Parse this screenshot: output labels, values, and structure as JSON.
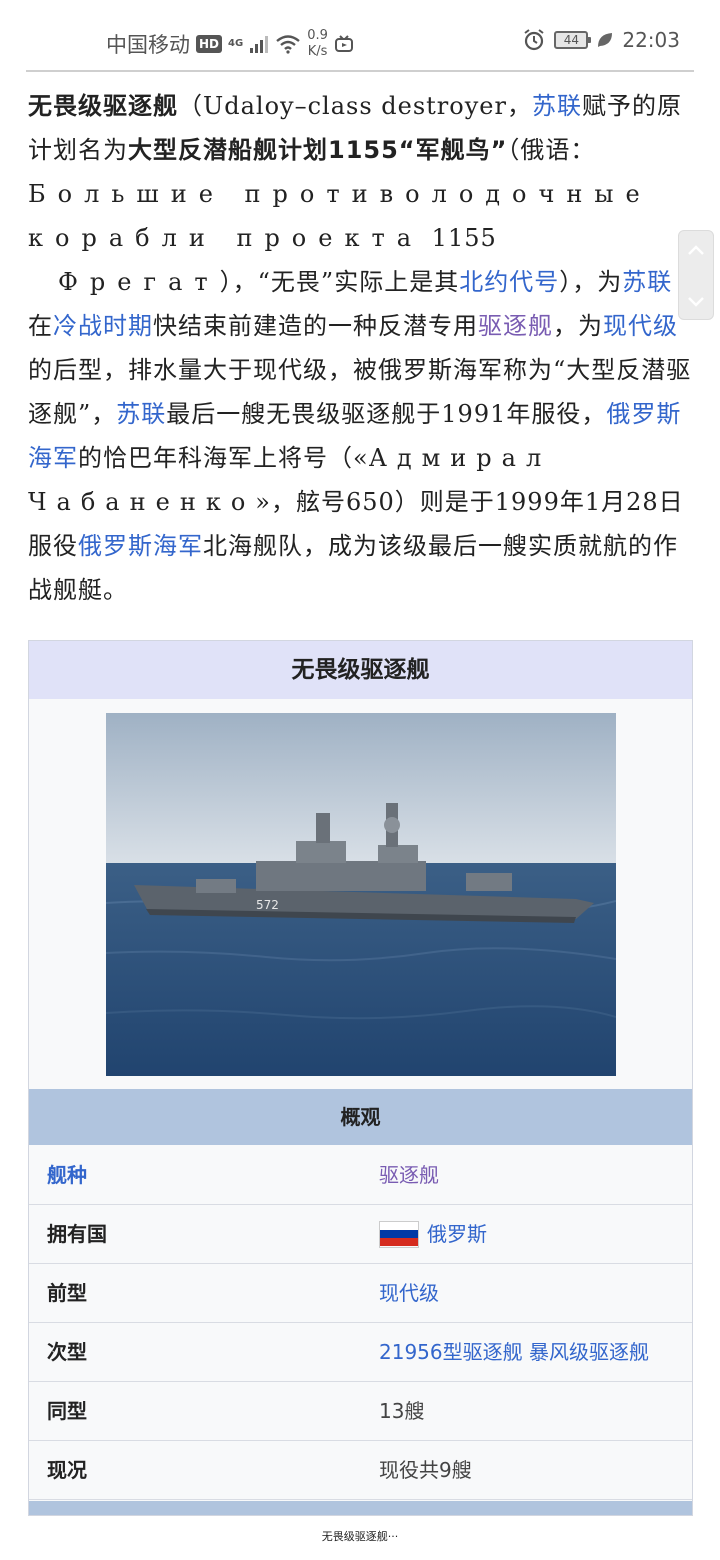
{
  "status_bar": {
    "carrier": "中国移动",
    "hd": "HD",
    "network": "4G",
    "speed_value": "0.9",
    "speed_unit": "K/s",
    "battery": "44",
    "time": "22:03"
  },
  "article": {
    "title_bold": "无畏级驱逐舰",
    "seg1": "（Udaloy–class destroyer，",
    "link_sulian1": "苏联",
    "seg2": "赋予的原计划名为",
    "plan_bold": "大型反潜船舰计划1155“军舰鸟”",
    "seg3": "（俄语：",
    "ru1": "Большие противолодочные",
    "ru2": "корабли проекта",
    "ru2_num": " 1155",
    "ru3": "Фрегат",
    "seg4": "），“无畏”实际上是其",
    "link_nato": "北约代号",
    "seg5": "），为",
    "link_sulian2": "苏联",
    "seg6": "在",
    "link_coldwar": "冷战时期",
    "seg7": "快结束前建造的一种反潜专用",
    "link_destroyer": "驱逐舰",
    "seg8": "，为",
    "link_sovremenny": "现代级",
    "seg9": "的后型，排水量大于现代级，被俄罗斯海军称为“大型反潜驱逐舰”，",
    "link_sulian3": "苏联",
    "seg10": "最后一艘无畏级驱逐舰于1991年服役，",
    "link_rusnavy1": "俄罗斯海军",
    "seg11": "的恰巴年科海军上将号（«",
    "ru4": "Адмирал Чабаненко",
    "seg12": "»，舷号650）则是于1999年1月28日服役",
    "link_rusnavy2": "俄罗斯海军",
    "seg13": "北海舰队，成为该级最后一艘实质就航的作战舰艇。"
  },
  "infobox": {
    "title": "无畏级驱逐舰",
    "section": "概观",
    "hull_number": "572",
    "rows": [
      {
        "key": "舰种",
        "value": "驱逐舰"
      },
      {
        "key": "拥有国",
        "value": "俄罗斯"
      },
      {
        "key": "前型",
        "value": "现代级"
      },
      {
        "key": "次型",
        "value": "21956型驱逐舰 暴风级驱逐舰"
      },
      {
        "key": "同型",
        "value": "13艘"
      },
      {
        "key": "现况",
        "value": "现役共9艘"
      }
    ]
  },
  "footer": {
    "caption": "无畏级驱逐舰···"
  },
  "colors": {
    "link": "#3366cc",
    "visited_link": "#795cb2",
    "infobox_title_bg": "#e0e2f8",
    "infobox_section_bg": "#b0c4de",
    "flag_white": "#ffffff",
    "flag_blue": "#0039a6",
    "flag_red": "#d52b1e"
  }
}
